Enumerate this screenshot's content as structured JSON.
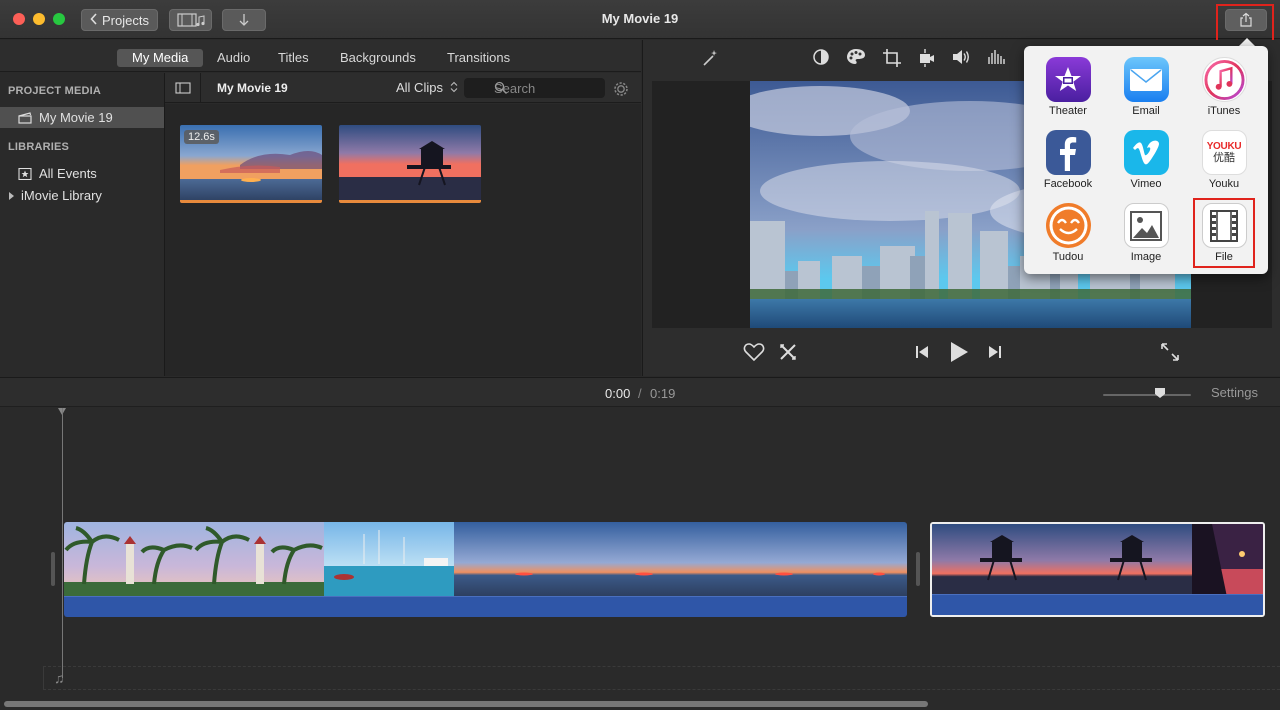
{
  "window": {
    "title": "My Movie 19",
    "projects_button": "Projects"
  },
  "browser_tabs": [
    "My Media",
    "Audio",
    "Titles",
    "Backgrounds",
    "Transitions"
  ],
  "sidebar": {
    "project_media_heading": "PROJECT MEDIA",
    "project_item": "My Movie 19",
    "libraries_heading": "LIBRARIES",
    "all_events": "All Events",
    "library": "iMovie Library"
  },
  "browser": {
    "title": "My Movie 19",
    "filter": "All Clips",
    "search_placeholder": "Search",
    "clips": [
      {
        "duration": "12.6s",
        "name": "sunset-clip"
      },
      {
        "name": "lifeguard-clip"
      }
    ]
  },
  "share_menu": {
    "items": [
      {
        "label": "Theater",
        "icon": "theater-icon"
      },
      {
        "label": "Email",
        "icon": "email-icon"
      },
      {
        "label": "iTunes",
        "icon": "itunes-icon"
      },
      {
        "label": "Facebook",
        "icon": "facebook-icon"
      },
      {
        "label": "Vimeo",
        "icon": "vimeo-icon"
      },
      {
        "label": "Youku",
        "icon": "youku-icon"
      },
      {
        "label": "Tudou",
        "icon": "tudou-icon"
      },
      {
        "label": "Image",
        "icon": "image-icon"
      },
      {
        "label": "File",
        "icon": "file-icon"
      }
    ],
    "youku_logo_text": "YOUKU",
    "youku_logo_cn": "优酷"
  },
  "timeline": {
    "current_time": "0:00",
    "separator": "/",
    "total_time": "0:19",
    "settings": "Settings"
  },
  "colors": {
    "accent_highlight": "#e0231c",
    "audio_track": "#2f56a8",
    "clip_bar": "#e88a3c"
  }
}
